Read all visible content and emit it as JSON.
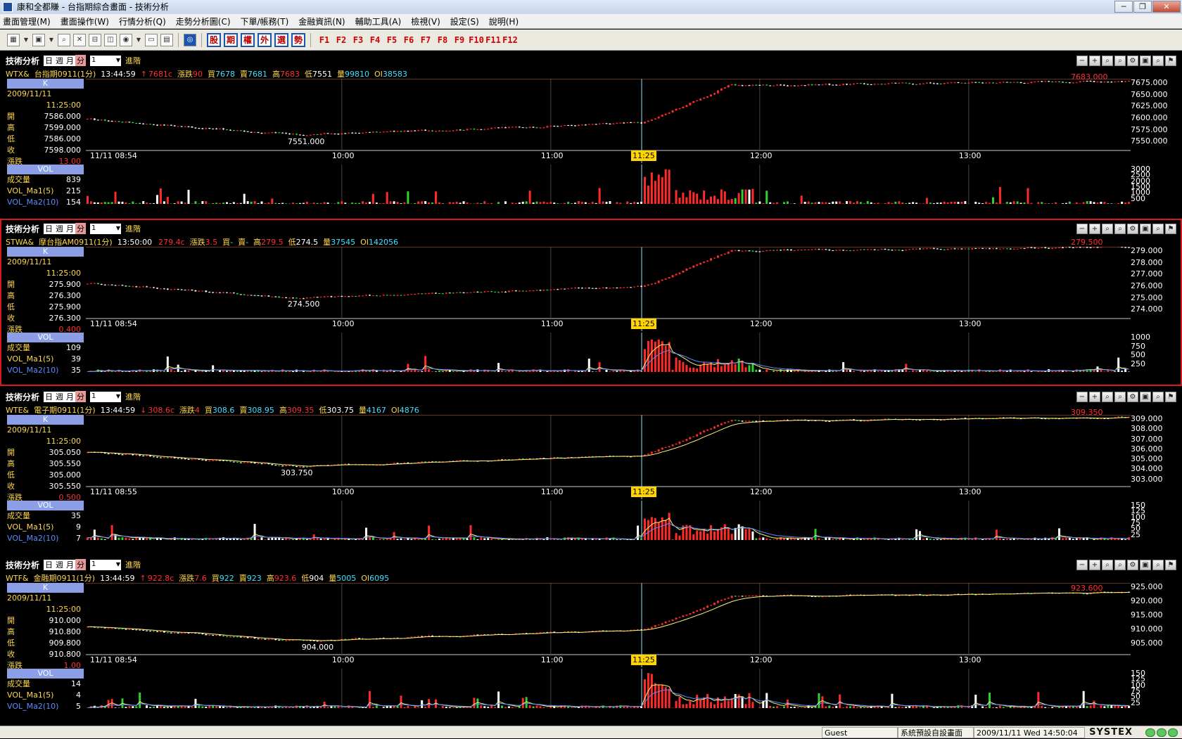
{
  "window": {
    "title": "康和全都賺 - 台指期綜合畫面 - 技術分析"
  },
  "menu": [
    "畫面管理(M)",
    "畫面操作(W)",
    "行情分析(Q)",
    "走勢分析圖(C)",
    "下單/帳務(T)",
    "金融資訊(N)",
    "輔助工具(A)",
    "檢視(V)",
    "設定(S)",
    "說明(H)"
  ],
  "toolbar": {
    "categories": [
      "股",
      "期",
      "權",
      "外",
      "選",
      "勢"
    ],
    "fkeys": [
      "F1",
      "F2",
      "F3",
      "F4",
      "F5",
      "F6",
      "F7",
      "F8",
      "F9",
      "F10",
      "F11",
      "F12"
    ]
  },
  "panel_common": {
    "title": "技術分析",
    "periods": [
      "日",
      "週",
      "月",
      "分"
    ],
    "interval": "1",
    "advanced": "進階",
    "k_label": "K",
    "vol_label": "VOL",
    "date": "2009/11/11",
    "time": "11:25:00",
    "labels": [
      "開",
      "高",
      "低",
      "收",
      "漲跌"
    ],
    "vol_labels": [
      "成交量",
      "VOL_Ma1(5)",
      "VOL_Ma2(10)"
    ],
    "x_ticks": [
      "10:00",
      "11:00",
      "12:00",
      "13:00"
    ],
    "cursor_time": "11:25"
  },
  "panels": [
    {
      "id": "WTX",
      "symbol": "WTX&",
      "name": "台指期0911(1分)",
      "quote_time": "13:44:59",
      "arrow": "↑",
      "price": "7681c",
      "chg_label": "漲跌",
      "chg": "90",
      "bid_label": "買",
      "bid": "7678",
      "ask_label": "賣",
      "ask": "7681",
      "high_label": "高",
      "high": "7683",
      "low_label": "低",
      "low": "7551",
      "vol_label": "量",
      "vol": "99810",
      "oi_label": "OI",
      "oi": "38583",
      "open": "7586.000",
      "hi": "7599.000",
      "lo": "7586.000",
      "close": "7598.000",
      "diff": "13.00",
      "start": "11/11 08:54",
      "max_label": "7683.000",
      "min_label": "7551.000",
      "vol_now": "839",
      "ma1": "215",
      "ma2": "154",
      "yticks": [
        "7675.000",
        "7650.000",
        "7625.000",
        "7600.000",
        "7575.000",
        "7550.000"
      ],
      "vticks": [
        "3000",
        "2500",
        "2000",
        "1500",
        "1000",
        "500"
      ]
    },
    {
      "id": "STWA",
      "symbol": "STWA&",
      "name": "摩台指AM0911(1分)",
      "quote_time": "13:50:00",
      "arrow": "",
      "price": "279.4c",
      "chg_label": "漲跌",
      "chg": "3.5",
      "bid_label": "買",
      "bid": "-",
      "ask_label": "賣",
      "ask": "-",
      "high_label": "高",
      "high": "279.5",
      "low_label": "低",
      "low": "274.5",
      "vol_label": "量",
      "vol": "37545",
      "oi_label": "OI",
      "oi": "142056",
      "open": "275.900",
      "hi": "276.300",
      "lo": "275.900",
      "close": "276.300",
      "diff": "0.400",
      "start": "11/11 08:54",
      "max_label": "279.500",
      "min_label": "274.500",
      "vol_now": "109",
      "ma1": "39",
      "ma2": "35",
      "yticks": [
        "279.000",
        "278.000",
        "277.000",
        "276.000",
        "275.000",
        "274.000"
      ],
      "vticks": [
        "1000",
        "750",
        "500",
        "250"
      ]
    },
    {
      "id": "WTE",
      "symbol": "WTE&",
      "name": "電子期0911(1分)",
      "quote_time": "13:44:59",
      "arrow": "↓",
      "price": "308.6c",
      "chg_label": "漲跌",
      "chg": "4",
      "bid_label": "買",
      "bid": "308.6",
      "ask_label": "賣",
      "ask": "308.95",
      "high_label": "高",
      "high": "309.35",
      "low_label": "低",
      "low": "303.75",
      "vol_label": "量",
      "vol": "4167",
      "oi_label": "OI",
      "oi": "4876",
      "open": "305.050",
      "hi": "305.550",
      "lo": "305.000",
      "close": "305.550",
      "diff": "0.500",
      "start": "11/11 08:55",
      "max_label": "309.350",
      "min_label": "303.750",
      "vol_now": "35",
      "ma1": "9",
      "ma2": "7",
      "yticks": [
        "309.000",
        "308.000",
        "307.000",
        "306.000",
        "305.000",
        "304.000",
        "303.000"
      ],
      "vticks": [
        "150",
        "125",
        "100",
        "75",
        "50",
        "25"
      ]
    },
    {
      "id": "WTF",
      "symbol": "WTF&",
      "name": "金融期0911(1分)",
      "quote_time": "13:44:59",
      "arrow": "↑",
      "price": "922.8c",
      "chg_label": "漲跌",
      "chg": "7.6",
      "bid_label": "買",
      "bid": "922",
      "ask_label": "賣",
      "ask": "923",
      "high_label": "高",
      "high": "923.6",
      "low_label": "低",
      "low": "904",
      "vol_label": "量",
      "vol": "5005",
      "oi_label": "OI",
      "oi": "6095",
      "open": "910.000",
      "hi": "910.800",
      "lo": "909.800",
      "close": "910.800",
      "diff": "1.00",
      "start": "11/11 08:54",
      "max_label": "923.600",
      "min_label": "904.000",
      "vol_now": "14",
      "ma1": "4",
      "ma2": "5",
      "yticks": [
        "925.000",
        "920.000",
        "915.000",
        "910.000",
        "905.000"
      ],
      "vticks": [
        "150",
        "125",
        "100",
        "75",
        "50",
        "25"
      ]
    }
  ],
  "status": {
    "user": "Guest",
    "layout": "系統預設自設畫面",
    "datetime": "2009/11/11 Wed 14:50:04",
    "brand": "SYSTEX"
  }
}
